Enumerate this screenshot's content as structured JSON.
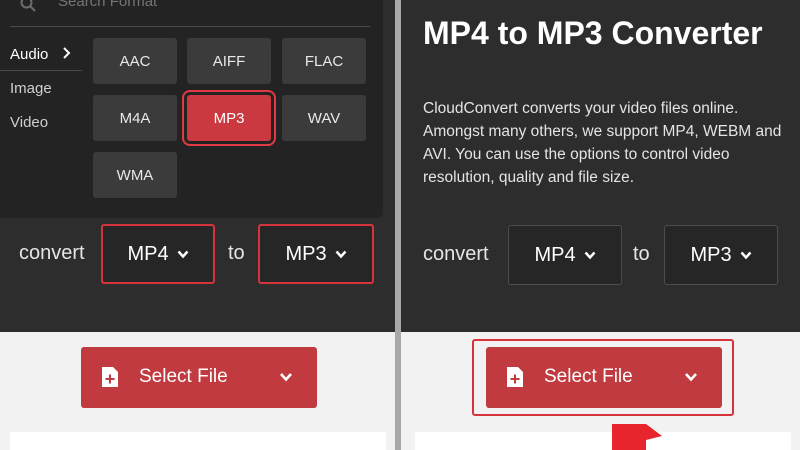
{
  "left_panel": {
    "search": {
      "placeholder": "Search Format"
    },
    "categories": [
      {
        "label": "Audio",
        "active": true
      },
      {
        "label": "Image",
        "active": false
      },
      {
        "label": "Video",
        "active": false
      }
    ],
    "formats": [
      {
        "label": "AAC",
        "selected": false
      },
      {
        "label": "AIFF",
        "selected": false
      },
      {
        "label": "FLAC",
        "selected": false
      },
      {
        "label": "M4A",
        "selected": false
      },
      {
        "label": "MP3",
        "selected": true
      },
      {
        "label": "WAV",
        "selected": false
      },
      {
        "label": "WMA",
        "selected": false
      }
    ],
    "convert_label": "convert",
    "from_format": "MP4",
    "to_label": "to",
    "to_format": "MP3",
    "select_file_label": "Select File"
  },
  "right_panel": {
    "title": "MP4 to MP3 Converter",
    "description": "CloudConvert converts your video files online. Amongst many others, we support MP4, WEBM and AVI. You can use the options to control video resolution, quality and file size.",
    "convert_label": "convert",
    "from_format": "MP4",
    "to_label": "to",
    "to_format": "MP3",
    "select_file_label": "Select File"
  },
  "colors": {
    "dark_bg": "#2d2d2d",
    "accent_red": "#c03a3f",
    "highlight_red": "#d7333c",
    "light_bg": "#f2f2f2"
  },
  "icons": [
    "search-icon",
    "chevron-right-icon",
    "chevron-down-icon",
    "file-plus-icon",
    "arrow-pointer-icon"
  ]
}
